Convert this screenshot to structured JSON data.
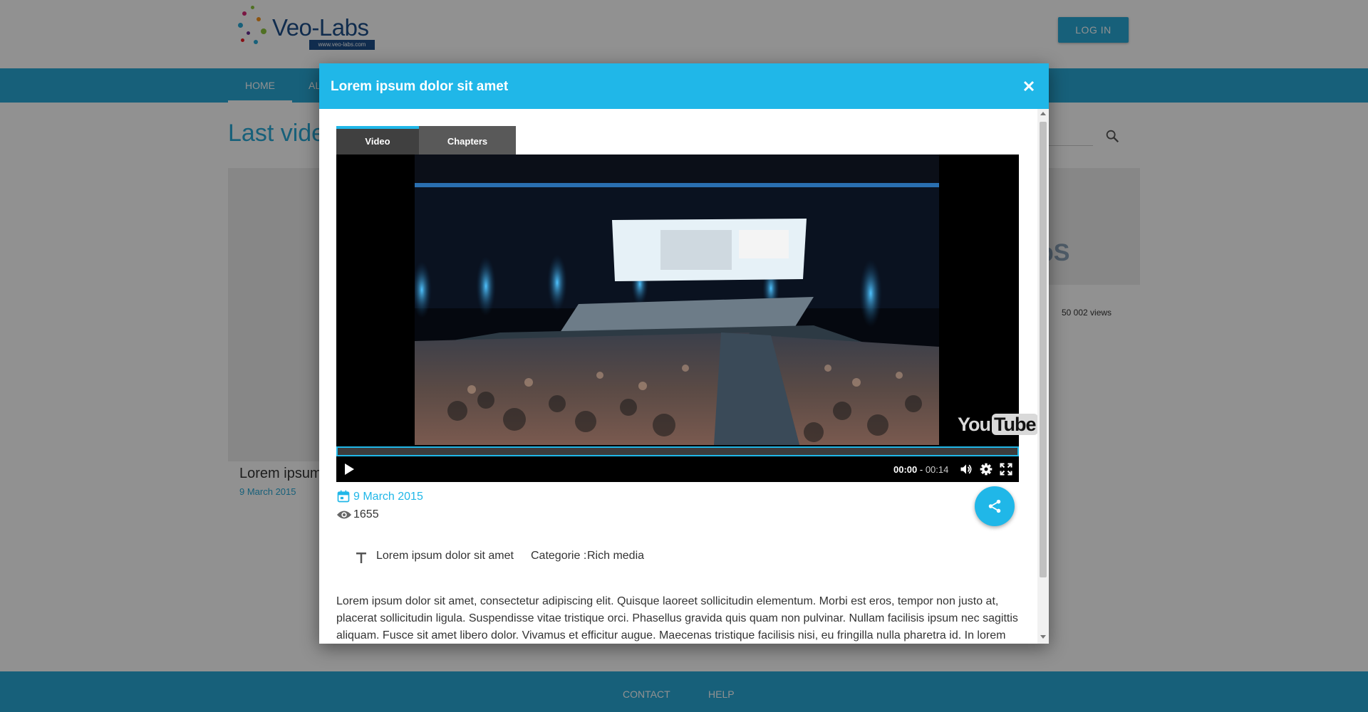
{
  "header": {
    "logo_text": "Veo-Labs",
    "logo_url": "www.veo-labs.com",
    "login_label": "LOG IN"
  },
  "nav": {
    "home_label": "HOME",
    "other_label": "AL"
  },
  "main": {
    "title": "Last vide",
    "card_left": {
      "title": "Lorem ipsum",
      "date": "9 March 2015"
    },
    "card_right": {
      "logo": "bS",
      "views": "50 002 views"
    }
  },
  "footer": {
    "contact_label": "CONTACT",
    "help_label": "HELP"
  },
  "modal": {
    "title": "Lorem ipsum dolor sit amet",
    "tabs": [
      {
        "label": "Video",
        "active": true
      },
      {
        "label": "Chapters",
        "active": false
      }
    ],
    "player": {
      "watermark": "You",
      "watermark_tube": "Tube",
      "time_current": "00:00",
      "time_separator": " - ",
      "time_total": "00:14",
      "icons": [
        "play-icon",
        "volume-icon",
        "settings-icon",
        "fullscreen-icon"
      ]
    },
    "meta": {
      "date": "9 March 2015",
      "views": "1655"
    },
    "info": {
      "title": "Lorem ipsum dolor sit amet",
      "category_label": "Categorie  :",
      "category_value": "Rich media"
    },
    "description": "Lorem ipsum dolor sit amet, consectetur adipiscing elit. Quisque laoreet sollicitudin elementum. Morbi est eros, tempor non justo at, placerat sollicitudin ligula. Suspendisse vitae tristique orci. Phasellus gravida quis quam non pulvinar. Nullam facilisis ipsum nec sagittis aliquam. Fusce sit amet libero dolor. Vivamus et efficitur augue. Maecenas tristique facilisis nisi, eu fringilla nulla pharetra id. In lorem"
  },
  "colors": {
    "accent": "#20b7e8",
    "nav_blue": "#29a9d6",
    "overlay": "rgba(0,0,0,0.43)"
  }
}
